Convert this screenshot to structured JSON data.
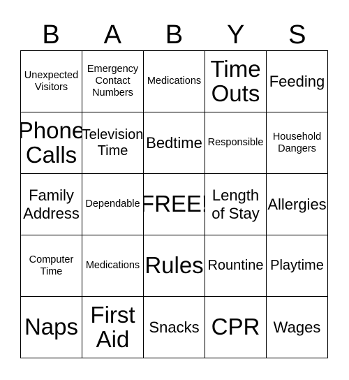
{
  "header": [
    "B",
    "A",
    "B",
    "Y",
    "S"
  ],
  "cells": [
    {
      "text": "Unexpected Visitors",
      "size": "s"
    },
    {
      "text": "Emergency Contact Numbers",
      "size": "s"
    },
    {
      "text": "Medications",
      "size": "s"
    },
    {
      "text": "Time Outs",
      "size": "x"
    },
    {
      "text": "Feeding",
      "size": "l"
    },
    {
      "text": "Phone Calls",
      "size": "x"
    },
    {
      "text": "Television Time",
      "size": "m"
    },
    {
      "text": "Bedtime",
      "size": "l"
    },
    {
      "text": "Responsible",
      "size": "s"
    },
    {
      "text": "Household Dangers",
      "size": "s"
    },
    {
      "text": "Family Address",
      "size": "l"
    },
    {
      "text": "Dependable",
      "size": "s"
    },
    {
      "text": "FREE!",
      "size": "x"
    },
    {
      "text": "Length of Stay",
      "size": "l"
    },
    {
      "text": "Allergies",
      "size": "l"
    },
    {
      "text": "Computer Time",
      "size": "s"
    },
    {
      "text": "Medications",
      "size": "s"
    },
    {
      "text": "Rules",
      "size": "x"
    },
    {
      "text": "Rountine",
      "size": "m"
    },
    {
      "text": "Playtime",
      "size": "m"
    },
    {
      "text": "Naps",
      "size": "x"
    },
    {
      "text": "First Aid",
      "size": "x"
    },
    {
      "text": "Snacks",
      "size": "l"
    },
    {
      "text": "CPR",
      "size": "x"
    },
    {
      "text": "Wages",
      "size": "l"
    }
  ]
}
